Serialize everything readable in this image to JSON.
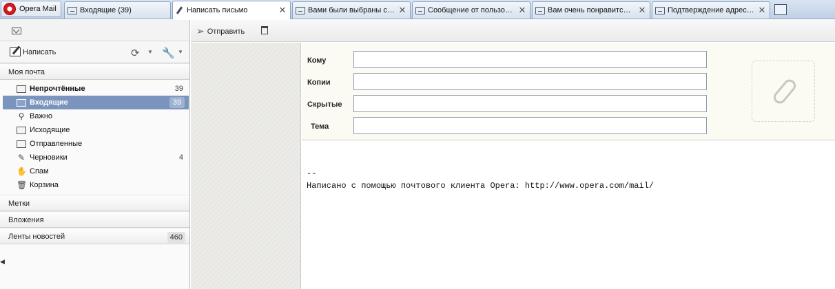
{
  "app": {
    "button_label": "Opera Mail"
  },
  "tabs": [
    {
      "label": "Входящие (39)",
      "icon": "mail-icon",
      "active": false
    },
    {
      "label": "Написать письмо",
      "icon": "pen-icon",
      "active": true
    },
    {
      "label": "Вами были выбраны сп…",
      "icon": "mail-icon",
      "active": false
    },
    {
      "label": "Сообщение от пользов…",
      "icon": "mail-icon",
      "active": false
    },
    {
      "label": "Вам очень понравится …",
      "icon": "mail-icon",
      "active": false
    },
    {
      "label": "Подтверждение адрес…",
      "icon": "mail-icon",
      "active": false
    }
  ],
  "tab_close_glyph": "✕",
  "sidebar": {
    "compose_label": "Написать",
    "my_mail_label": "Моя почта",
    "folders": [
      {
        "label": "Непрочтённые",
        "count": "39",
        "icon": "unread-icon",
        "bold": true
      },
      {
        "label": "Входящие",
        "count": "39",
        "icon": "inbox-icon",
        "selected": true
      },
      {
        "label": "Важно",
        "count": "",
        "icon": "pin-icon"
      },
      {
        "label": "Исходящие",
        "count": "",
        "icon": "outbox-icon"
      },
      {
        "label": "Отправленные",
        "count": "",
        "icon": "sent-icon"
      },
      {
        "label": "Черновики",
        "count": "4",
        "icon": "draft-icon"
      },
      {
        "label": "Спам",
        "count": "",
        "icon": "spam-hand-icon"
      },
      {
        "label": "Корзина",
        "count": "",
        "icon": "trash-icon"
      }
    ],
    "sections": [
      {
        "label": "Метки",
        "count": ""
      },
      {
        "label": "Вложения",
        "count": ""
      },
      {
        "label": "Ленты новостей",
        "count": "460"
      }
    ]
  },
  "toolbar": {
    "send_label": "Отправить"
  },
  "compose": {
    "to_label": "Кому",
    "cc_label": "Копии",
    "bcc_label": "Скрытые",
    "subject_label": "Тема",
    "to_value": "",
    "cc_value": "",
    "bcc_value": "",
    "subject_value": "",
    "signature_separator": "--",
    "signature_text": "Написано с помощью почтового клиента Opera: http://www.opera.com/mail/"
  }
}
